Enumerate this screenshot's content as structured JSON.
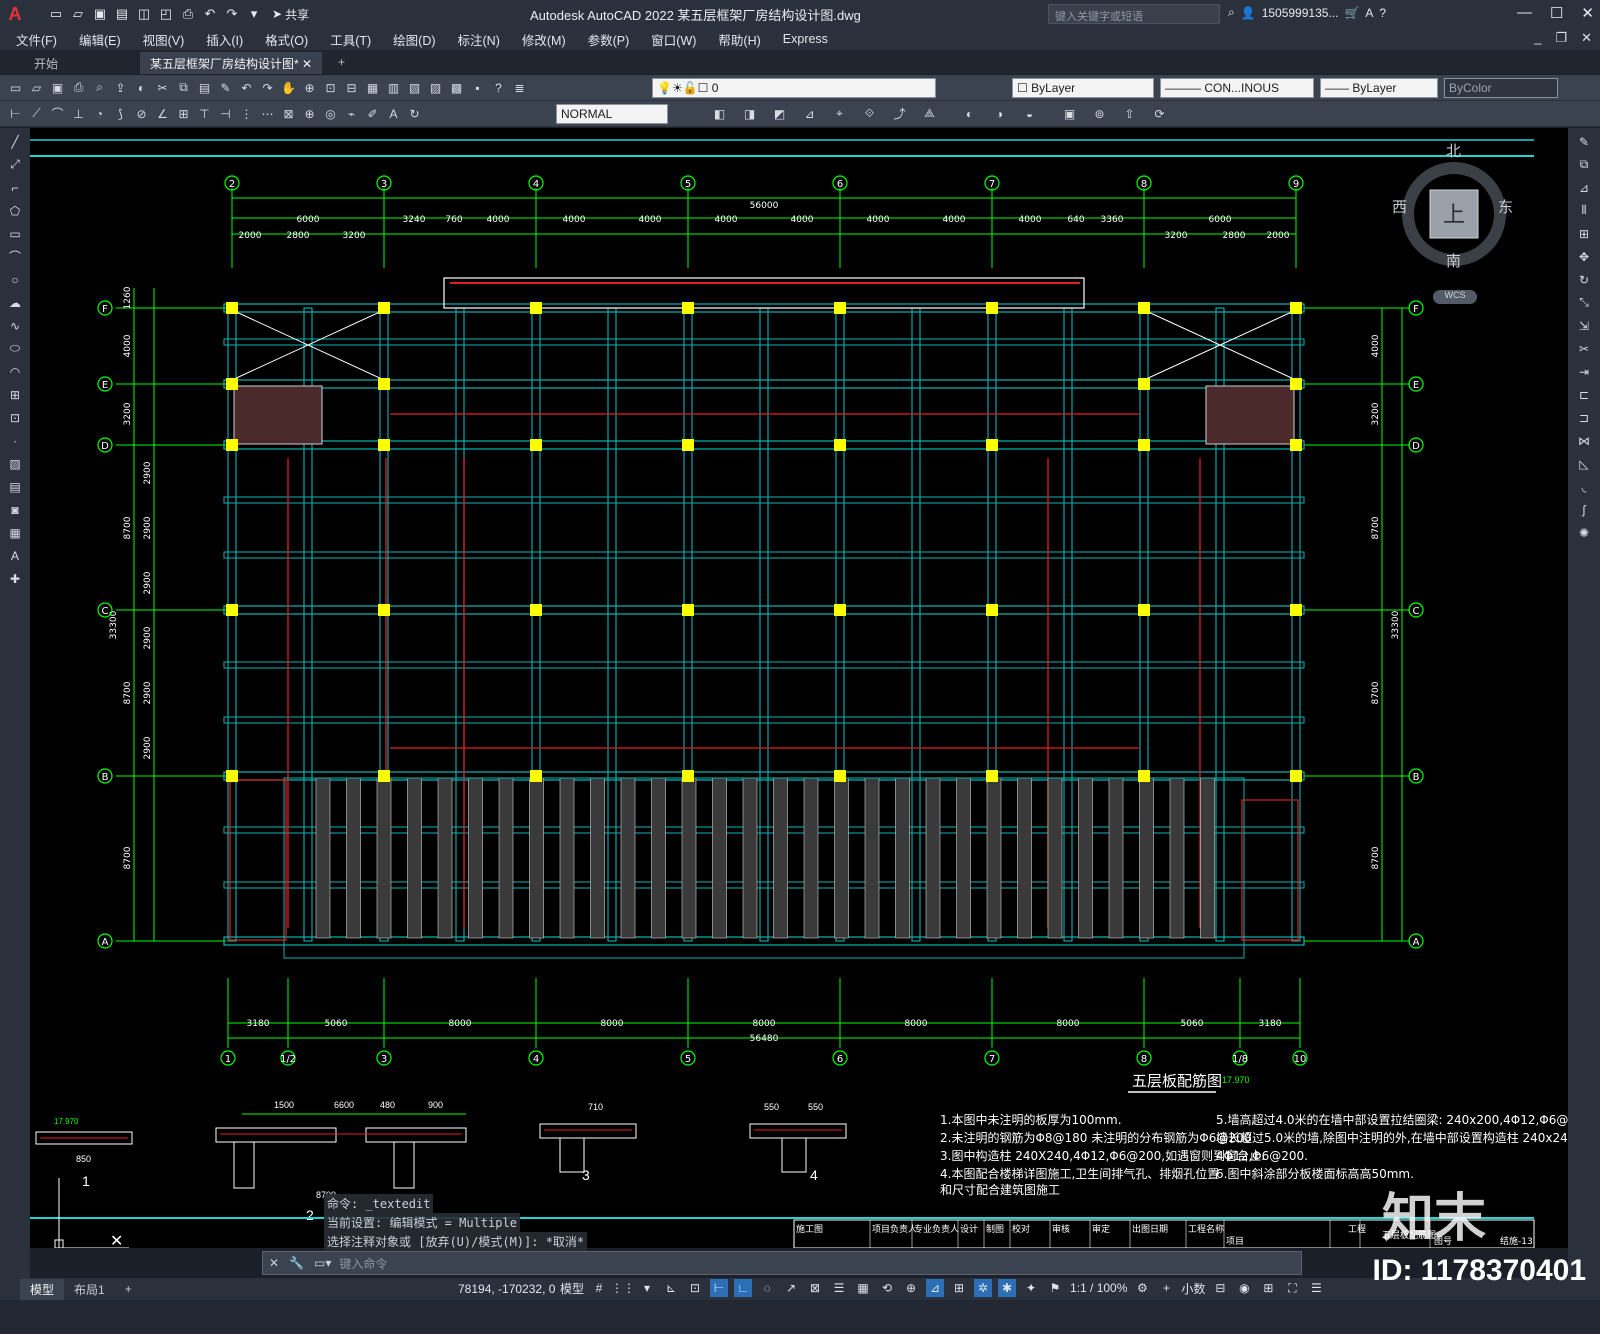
{
  "app": {
    "title": "Autodesk AutoCAD 2022    某五层框架厂房结构设计图.dwg",
    "search_placeholder": "键入关键字或短语",
    "user": "1505999135...",
    "share_label": "共享"
  },
  "menu": [
    "文件(F)",
    "编辑(E)",
    "视图(V)",
    "插入(I)",
    "格式(O)",
    "工具(T)",
    "绘图(D)",
    "标注(N)",
    "修改(M)",
    "参数(P)",
    "窗口(W)",
    "帮助(H)",
    "Express"
  ],
  "tabs": [
    {
      "label": "开始"
    },
    {
      "label": "某五层框架厂房结构设计图*"
    }
  ],
  "toolbar": {
    "layer_value": "0",
    "color_value": "ByLayer",
    "linetype_value": "CON...INOUS",
    "lineweight_value": "ByLayer",
    "plotstyle_value": "ByColor",
    "textstyle_value": "NORMAL"
  },
  "drawing": {
    "plan_title": "五层板配筋图",
    "elev_mark": "17.970",
    "top_total": "56000",
    "bottom_total": "56480",
    "top_dims_1": [
      "6000",
      "3240",
      "760",
      "4000",
      "4000",
      "4000",
      "4000",
      "4000",
      "4000",
      "4000",
      "4000",
      "640",
      "3360",
      "6000"
    ],
    "top_dims_2_left": [
      "2000",
      "2800",
      "3200"
    ],
    "top_dims_2_right": [
      "3200",
      "2800",
      "2000"
    ],
    "bottom_dims": [
      "3180",
      "5060",
      "8000",
      "8000",
      "8000",
      "8000",
      "8000",
      "5060",
      "3180"
    ],
    "top_axes": [
      "2",
      "3",
      "4",
      "5",
      "6",
      "7",
      "8",
      "9"
    ],
    "bottom_axes": [
      "1",
      "1/2",
      "3",
      "4",
      "5",
      "6",
      "7",
      "8",
      "1/8",
      "10"
    ],
    "row_axes": [
      "F",
      "E",
      "D",
      "C",
      "B",
      "A"
    ],
    "left_dims_outer": [
      "1260",
      "4000",
      "3200",
      "8700",
      "8700",
      "8700"
    ],
    "left_dims_inner": [
      "2900",
      "2900",
      "2900",
      "2900",
      "2900",
      "2900"
    ],
    "left_total": "33300",
    "right_dims": [
      "4000",
      "3200",
      "8700",
      "8700",
      "8700"
    ],
    "right_total": "33300",
    "notes_left": [
      "1.本图中未注明的板厚为100mm.",
      "2.未注明的钢筋为Φ8@180  未注明的分布钢筋为Φ6@200",
      "3.图中构造柱 240X240,4Φ12,Φ6@200,如遇窗则到窗台止.",
      "4.本图配合楼梯详图施工,卫生间排气孔、排烟孔位置",
      "  和尺寸配合建筑图施工"
    ],
    "notes_right": [
      "5.墙高超过4.0米的在墙中部设置拉结圈梁: 240x200,4Φ12,Φ6@200.",
      "  墙长超过5.0米的墙,除图中注明的外,在墙中部设置构造柱 240x240,",
      "  4Φ12,Φ6@200.",
      "6.图中斜涂部分板楼面标高高50mm."
    ],
    "section_labels": [
      "1",
      "2",
      "3",
      "4"
    ],
    "section_dims": [
      "1500",
      "6600",
      "480",
      "900",
      "8700",
      "710",
      "550",
      "550",
      "850",
      "17.970"
    ],
    "titleblock": [
      "施工图",
      "项目负责人",
      "专业负责人",
      "设计",
      "制图",
      "校对",
      "审核",
      "审定",
      "出图日期",
      "工程名称",
      "项目",
      "工程",
      "图号",
      "结施-13",
      "五层板配筋图"
    ],
    "north": "北",
    "south": "南",
    "east": "东",
    "west": "西",
    "cube_face": "上",
    "wcs": "WCS"
  },
  "command": {
    "history": [
      "命令: _textedit",
      "当前设置: 编辑模式 = Multiple",
      "选择注释对象或 [放弃(U)/模式(M)]: *取消*"
    ],
    "input_placeholder": "键入命令"
  },
  "status": {
    "layouts": [
      "模型",
      "布局1"
    ],
    "coords": "78194, -170232, 0",
    "model_label": "模型",
    "scale": "1:1 / 100%",
    "units": "小数"
  },
  "watermark": {
    "logo": "知末",
    "id": "ID: 1178370401"
  },
  "colors": {
    "grid_cyan": "#1fd6d6",
    "beam_teal": "#0fb3b3",
    "column_yellow": "#ffff00",
    "dim_green": "#00ff00",
    "rebar_red": "#e02020",
    "canvas_bg": "#000000"
  }
}
